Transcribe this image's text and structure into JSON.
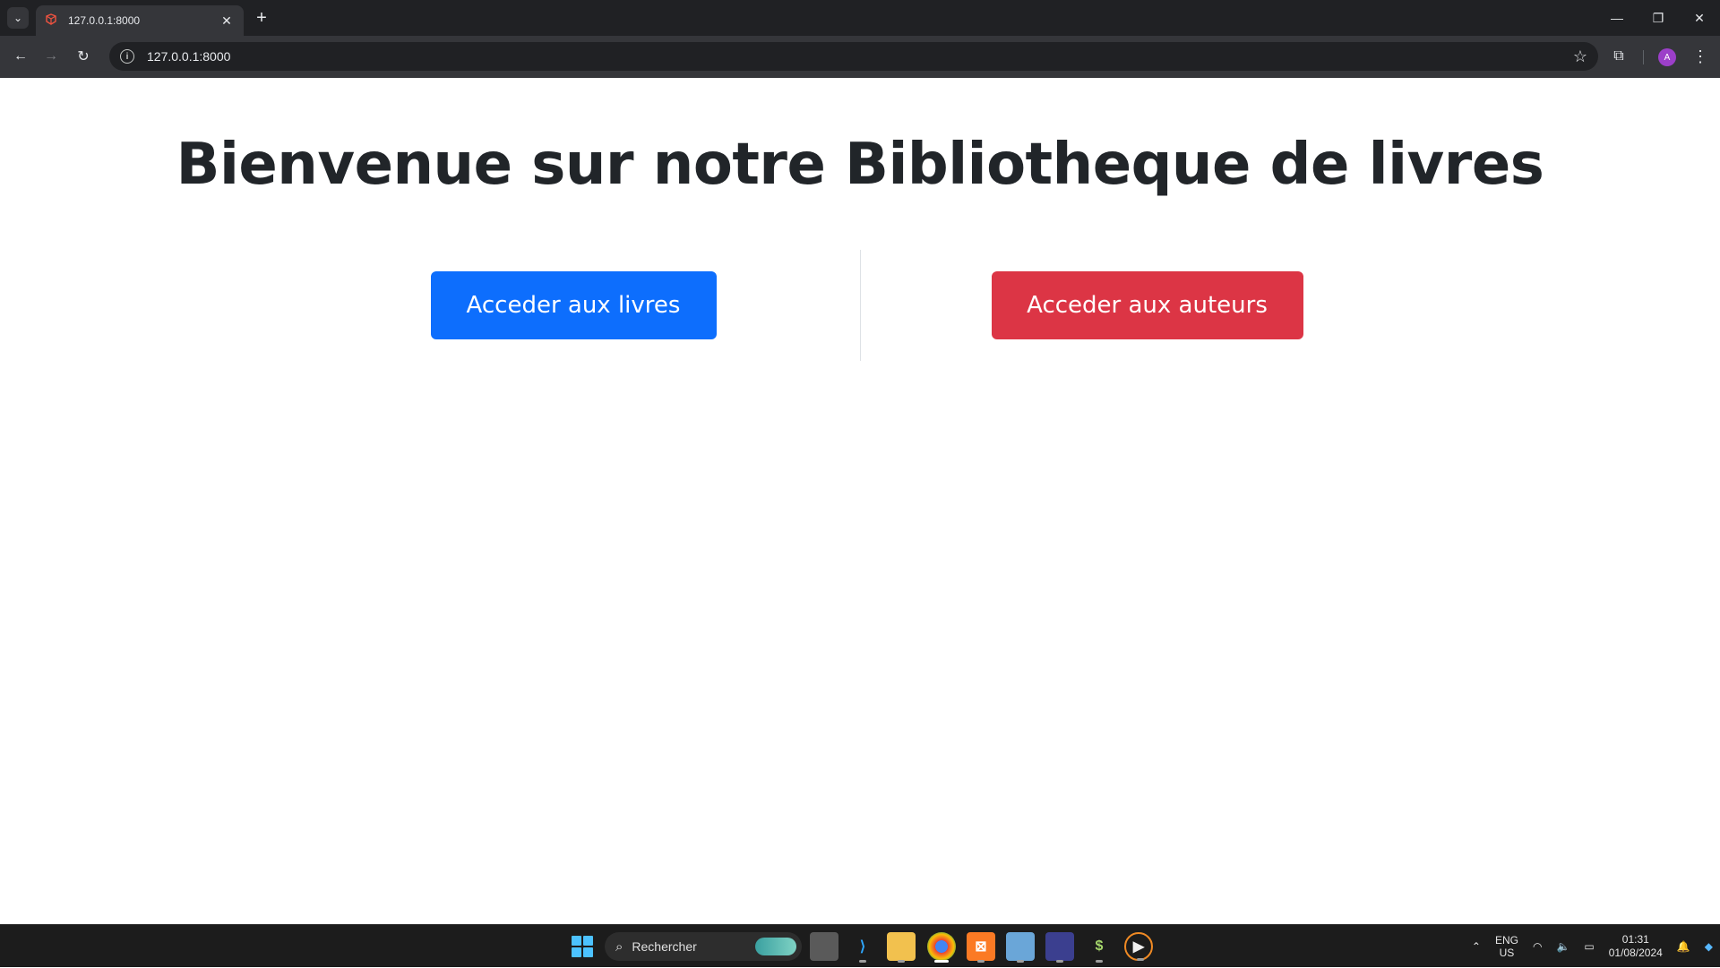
{
  "browser": {
    "tab_title": "127.0.0.1:8000",
    "url": "127.0.0.1:8000",
    "new_tab_symbol": "+",
    "avatar_initial": "A"
  },
  "page": {
    "title": "Bienvenue sur notre Bibliotheque de livres",
    "books_button": "Acceder aux livres",
    "authors_button": "Acceder aux auteurs"
  },
  "taskbar": {
    "search_placeholder": "Rechercher",
    "language_line1": "ENG",
    "language_line2": "US",
    "time": "01:31",
    "date": "01/08/2024"
  },
  "colors": {
    "primary": "#0d6efd",
    "danger": "#dc3545",
    "title_text": "#212529"
  }
}
